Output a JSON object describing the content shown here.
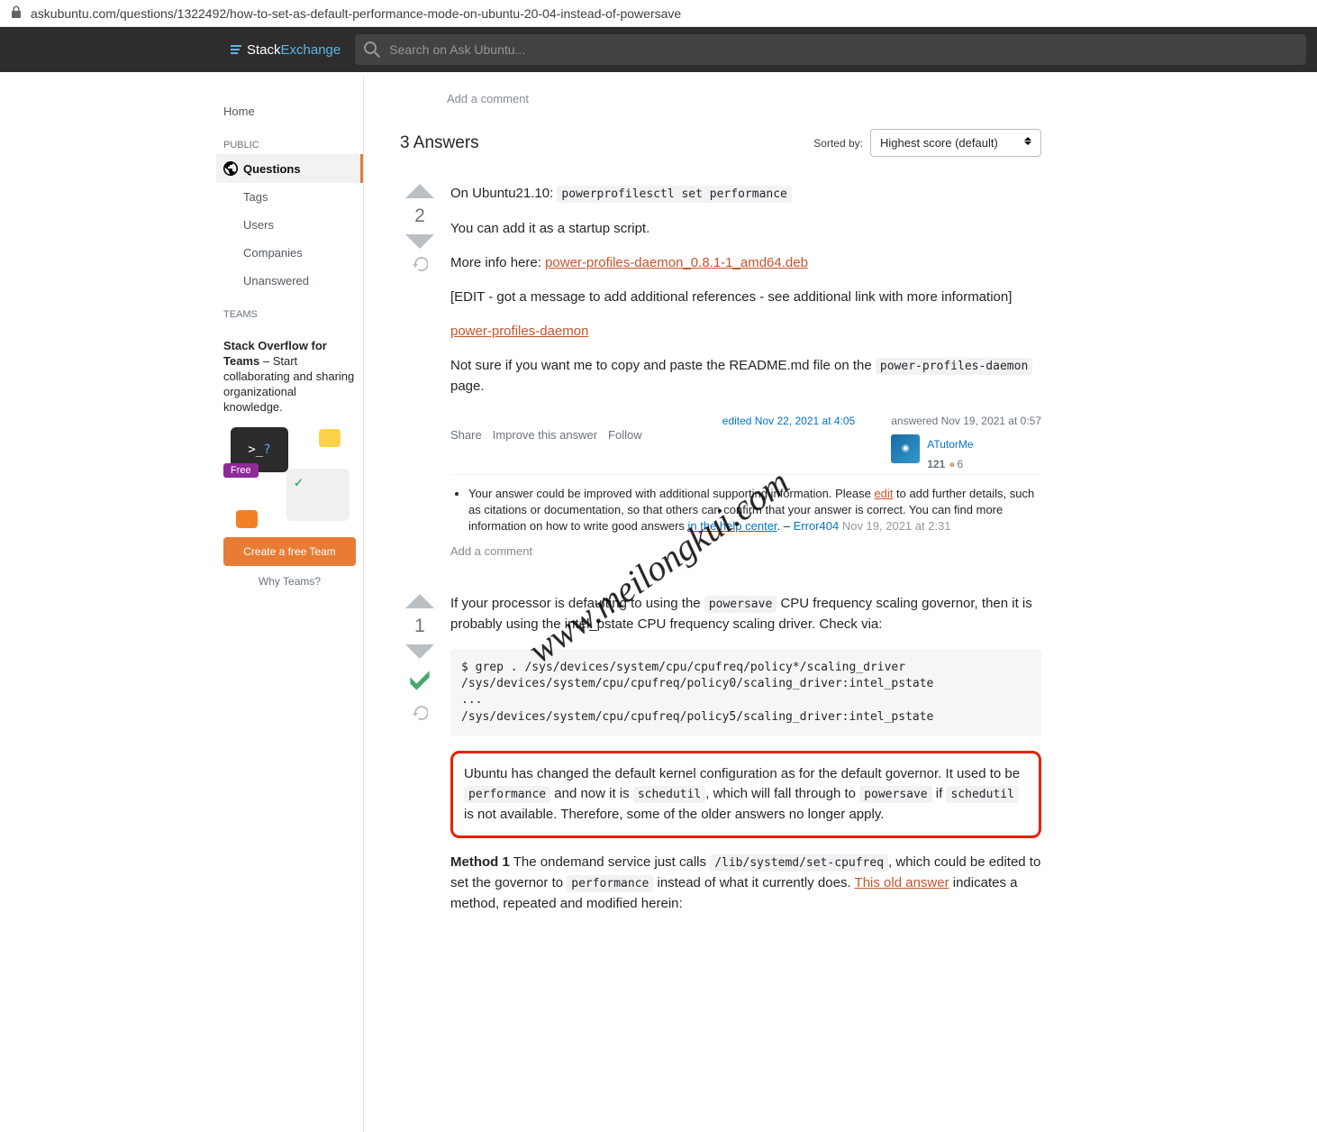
{
  "url": "askubuntu.com/questions/1322492/how-to-set-as-default-performance-mode-on-ubuntu-20-04-instead-of-powersave",
  "topbar": {
    "brand1": "Stack",
    "brand2": "Exchange",
    "search_placeholder": "Search on Ask Ubuntu..."
  },
  "leftnav": {
    "home": "Home",
    "public": "PUBLIC",
    "questions": "Questions",
    "tags": "Tags",
    "users": "Users",
    "companies": "Companies",
    "unanswered": "Unanswered",
    "teams": "TEAMS"
  },
  "teamsbox": {
    "title_bold": "Stack Overflow for Teams",
    "title_rest": " – Start collaborating and sharing organizational knowledge.",
    "free": "Free",
    "terminal": ">_?",
    "cta": "Create a free Team",
    "why": "Why Teams?"
  },
  "addcomment": "Add a comment",
  "answers": {
    "title": "3 Answers",
    "sorted_label": "Sorted by:",
    "sort_value": "Highest score (default)"
  },
  "a1": {
    "votes": "2",
    "p1a": "On Ubuntu21.10: ",
    "p1code": "powerprofilesctl set performance",
    "p2": "You can add it as a startup script.",
    "p3a": "More info here: ",
    "p3link": "power-profiles-daemon_0.8.1-1_amd64.deb",
    "p4": "[EDIT - got a message to add additional references - see additional link with more information]",
    "p5link": "power-profiles-daemon",
    "p6a": "Not sure if you want me to copy and paste the README.md file on the ",
    "p6code": "power-profiles-daemon",
    "p6b": " page.",
    "share": "Share",
    "improve": "Improve this answer",
    "follow": "Follow",
    "edited": "edited Nov 22, 2021 at 4:05",
    "answered": "answered Nov 19, 2021 at 0:57",
    "username": "ATutorMe",
    "rep": "121",
    "bronze": "6",
    "comment_a": "Your answer could be improved with additional supporting information. Please ",
    "comment_edit": "edit",
    "comment_b": " to add further details, such as citations or documentation, so that others can confirm that your answer is correct. You can find more information on how to write good answers ",
    "comment_help": "in the help center",
    "comment_c": ". – ",
    "comment_user": "Error404",
    "comment_time": "Nov 19, 2021 at 2:31"
  },
  "a2": {
    "votes": "1",
    "p1a": "If your processor is defaulting to using the ",
    "p1c1": "powersave",
    "p1b": " CPU frequency scaling governor, then it is probably using the intel_pstate CPU frequency scaling driver. Check via:",
    "pre": "$ grep . /sys/devices/system/cpu/cpufreq/policy*/scaling_driver\n/sys/devices/system/cpu/cpufreq/policy0/scaling_driver:intel_pstate\n...\n/sys/devices/system/cpu/cpufreq/policy5/scaling_driver:intel_pstate",
    "box_a": "Ubuntu has changed the default kernel configuration as for the default governor. It used to be ",
    "box_c1": "performance",
    "box_b": " and now it is ",
    "box_c2": "schedutil",
    "box_c": ", which will fall through to ",
    "box_c3": "powersave",
    "box_d": " if ",
    "box_c4": "schedutil",
    "box_e": " is not available. Therefore, some of the older answers no longer apply.",
    "m1_b": "Method 1",
    "m1_a": " The ondemand service just calls ",
    "m1_c1": "/lib/systemd/set-cpufreq",
    "m1_c": ", which could be edited to set the governor to ",
    "m1_c2": "performance",
    "m1_d": " instead of what it currently does. ",
    "m1_link": "This old answer",
    "m1_e": " indicates a method, repeated and modified herein:"
  },
  "watermark": "www.meilongkui.com"
}
